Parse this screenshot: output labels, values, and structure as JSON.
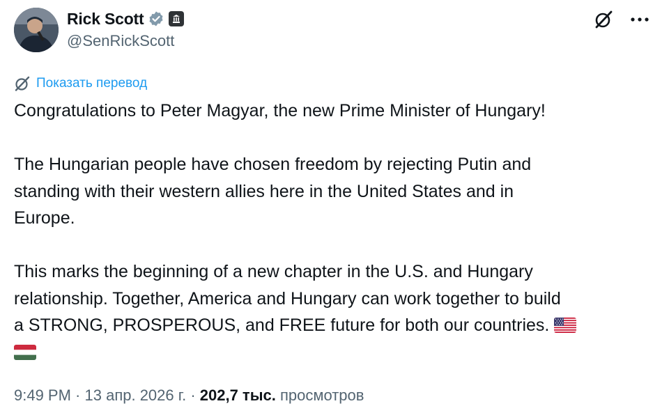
{
  "author": {
    "display_name": "Rick Scott",
    "handle": "@SenRickScott"
  },
  "icons": {
    "avatar": "avatar-photo",
    "verified": "verified-badge-icon",
    "government": "government-building-icon",
    "grok": "grok-icon",
    "more": "more-icon",
    "translate": "translate-icon"
  },
  "translate_label": "Показать перевод",
  "body": {
    "p1": "Congratulations to Peter Magyar, the new Prime Minister of Hungary!",
    "p2_line1": "The Hungarian people have chosen freedom by rejecting Putin and",
    "p2_line2": "standing with their western allies here in the United States and in",
    "p2_line3": "Europe.",
    "p3_line1": "This marks the beginning of a new chapter in the U.S. and Hungary",
    "p3_line2": "relationship. Together, America and Hungary can work together to build",
    "p3_line3": "a STRONG, PROSPEROUS, and FREE future for both our countries."
  },
  "emoji": [
    "flag-us",
    "flag-hungary"
  ],
  "meta": {
    "time": "9:49 PM",
    "sep1": " · ",
    "date": "13 апр. 2026 г.",
    "sep2": " · ",
    "views_count": "202,7 тыс.",
    "views_label": " просмотров"
  },
  "colors": {
    "link": "#1d9bf0",
    "text": "#0f1419",
    "secondary": "#536471"
  }
}
